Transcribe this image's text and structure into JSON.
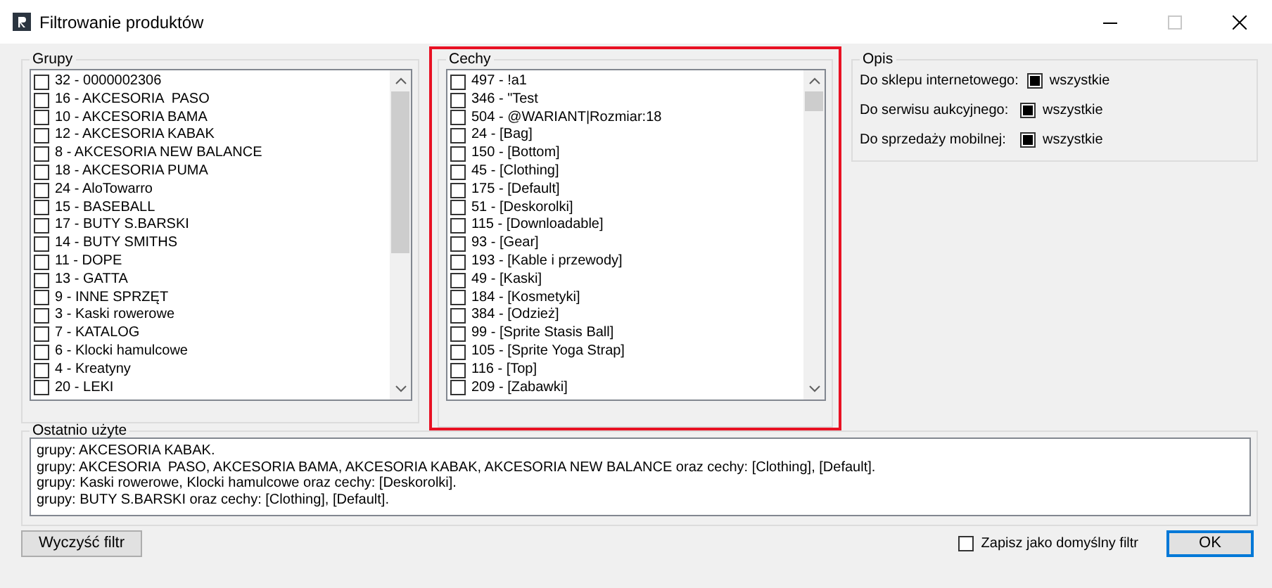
{
  "window": {
    "title": "Filtrowanie produktów",
    "maximize_disabled": true
  },
  "groups": {
    "title": "Grupy",
    "items": [
      {
        "label": "32 - 0000002306",
        "checked": false
      },
      {
        "label": "16 - AKCESORIA  PASO",
        "checked": false
      },
      {
        "label": "10 - AKCESORIA BAMA",
        "checked": false
      },
      {
        "label": "12 - AKCESORIA KABAK",
        "checked": false
      },
      {
        "label": "8 - AKCESORIA NEW BALANCE",
        "checked": false
      },
      {
        "label": "18 - AKCESORIA PUMA",
        "checked": false
      },
      {
        "label": "24 - AloTowarro",
        "checked": false
      },
      {
        "label": "15 - BASEBALL",
        "checked": false
      },
      {
        "label": "17 - BUTY S.BARSKI",
        "checked": false
      },
      {
        "label": "14 - BUTY SMITHS",
        "checked": false
      },
      {
        "label": "11 - DOPE",
        "checked": false
      },
      {
        "label": "13 - GATTA",
        "checked": false
      },
      {
        "label": "9 - INNE SPRZĘT",
        "checked": false
      },
      {
        "label": "3 - Kaski rowerowe",
        "checked": false
      },
      {
        "label": "7 - KATALOG",
        "checked": false
      },
      {
        "label": "6 - Klocki hamulcowe",
        "checked": false
      },
      {
        "label": "4 - Kreatyny",
        "checked": false
      },
      {
        "label": "20 - LEKI",
        "checked": false
      }
    ]
  },
  "features": {
    "title": "Cechy",
    "highlighted": true,
    "items": [
      {
        "label": "497 - !a1",
        "checked": false
      },
      {
        "label": "346 - \"Test",
        "checked": false
      },
      {
        "label": "504 - @WARIANT|Rozmiar:18",
        "checked": false
      },
      {
        "label": "24 - [Bag]",
        "checked": false
      },
      {
        "label": "150 - [Bottom]",
        "checked": false
      },
      {
        "label": "45 - [Clothing]",
        "checked": false
      },
      {
        "label": "175 - [Default]",
        "checked": false
      },
      {
        "label": "51 - [Deskorolki]",
        "checked": false
      },
      {
        "label": "115 - [Downloadable]",
        "checked": false
      },
      {
        "label": "93 - [Gear]",
        "checked": false
      },
      {
        "label": "193 - [Kable i przewody]",
        "checked": false
      },
      {
        "label": "49 - [Kaski]",
        "checked": false
      },
      {
        "label": "184 - [Kosmetyki]",
        "checked": false
      },
      {
        "label": "384 - [Odzież]",
        "checked": false
      },
      {
        "label": "99 - [Sprite Stasis Ball]",
        "checked": false
      },
      {
        "label": "105 - [Sprite Yoga Strap]",
        "checked": false
      },
      {
        "label": "116 - [Top]",
        "checked": false
      },
      {
        "label": "209 - [Zabawki]",
        "checked": false
      }
    ]
  },
  "description": {
    "title": "Opis",
    "rows": [
      {
        "label": "Do sklepu internetowego:",
        "option": "wszystkie",
        "indeterminate": true
      },
      {
        "label": "Do serwisu aukcyjnego:",
        "option": "wszystkie",
        "indeterminate": true
      },
      {
        "label": "Do sprzedaży mobilnej:",
        "option": "wszystkie",
        "indeterminate": true
      }
    ]
  },
  "recent": {
    "title": "Ostatnio użyte",
    "lines": [
      "grupy: AKCESORIA KABAK.",
      "grupy: AKCESORIA  PASO, AKCESORIA BAMA, AKCESORIA KABAK, AKCESORIA NEW BALANCE oraz cechy: [Clothing], [Default].",
      "grupy: Kaski rowerowe, Klocki hamulcowe oraz cechy: [Deskorolki].",
      "grupy: BUTY S.BARSKI oraz cechy: [Clothing], [Default]."
    ]
  },
  "footer": {
    "clear_button": "Wyczyść filtr",
    "save_default": {
      "label": "Zapisz jako domyślny filtr",
      "checked": false
    },
    "ok_button": "OK"
  }
}
